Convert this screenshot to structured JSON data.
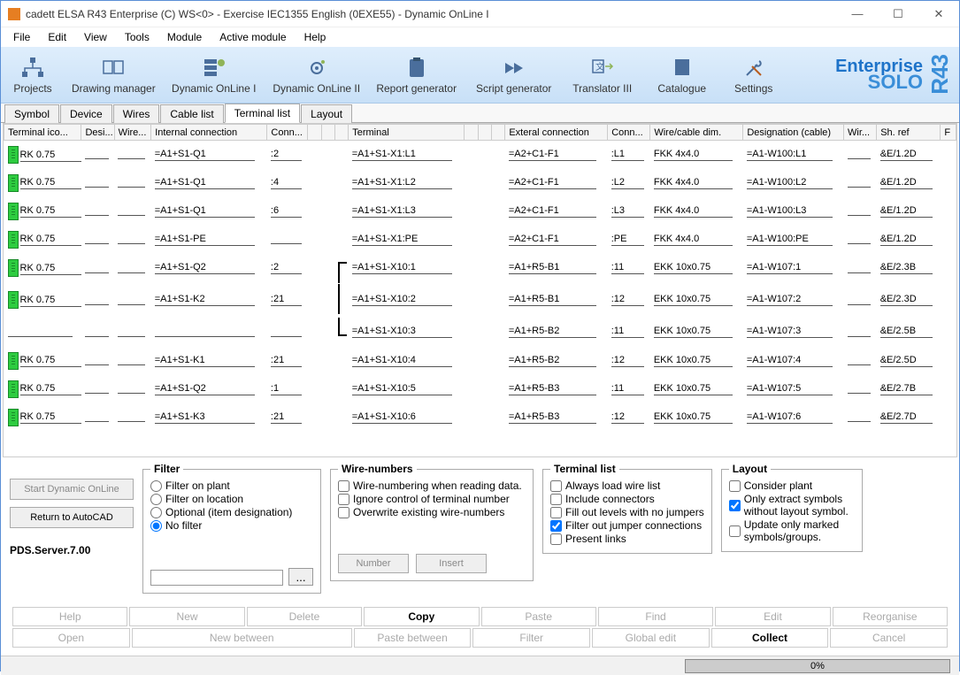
{
  "title": "cadett ELSA R43 Enterprise (C) WS<0> - Exercise IEC1355 English (0EXE55) - Dynamic OnLine I",
  "menu": [
    "File",
    "Edit",
    "View",
    "Tools",
    "Module",
    "Active module",
    "Help"
  ],
  "toolbar": [
    {
      "id": "projects",
      "label": "Projects"
    },
    {
      "id": "drawing-manager",
      "label": "Drawing manager"
    },
    {
      "id": "dynamic-online-1",
      "label": "Dynamic OnLine I"
    },
    {
      "id": "dynamic-online-2",
      "label": "Dynamic OnLine II"
    },
    {
      "id": "report-generator",
      "label": "Report generator"
    },
    {
      "id": "script-generator",
      "label": "Script generator"
    },
    {
      "id": "translator",
      "label": "Translator III"
    },
    {
      "id": "catalogue",
      "label": "Catalogue"
    },
    {
      "id": "settings",
      "label": "Settings"
    }
  ],
  "brand": {
    "line1": "Enterprise",
    "line2": "SOLO",
    "tag": "R43"
  },
  "tabs": [
    "Symbol",
    "Device",
    "Wires",
    "Cable list",
    "Terminal list",
    "Layout"
  ],
  "active_tab": "Terminal list",
  "columns": [
    "Terminal ico...",
    "Desi...",
    "Wire...",
    "Internal connection",
    "Conn...",
    "",
    "",
    "",
    "Terminal",
    "",
    "",
    "",
    "Exteral connection",
    "Conn...",
    "Wire/cable dim.",
    "Designation (cable)",
    "Wir...",
    "Sh. ref",
    "F"
  ],
  "rows": [
    {
      "tic": "RK 0.75",
      "int": "=A1+S1-Q1",
      "c1": ":2",
      "term": "=A1+S1-X1:L1",
      "ext": "=A2+C1-F1",
      "c2": ":L1",
      "dim": "FKK 4x4.0",
      "des": "=A1-W100:L1",
      "sh": "&E/1.2D"
    },
    {
      "tic": "RK 0.75",
      "int": "=A1+S1-Q1",
      "c1": ":4",
      "term": "=A1+S1-X1:L2",
      "ext": "=A2+C1-F1",
      "c2": ":L2",
      "dim": "FKK 4x4.0",
      "des": "=A1-W100:L2",
      "sh": "&E/1.2D"
    },
    {
      "tic": "RK 0.75",
      "int": "=A1+S1-Q1",
      "c1": ":6",
      "term": "=A1+S1-X1:L3",
      "ext": "=A2+C1-F1",
      "c2": ":L3",
      "dim": "FKK 4x4.0",
      "des": "=A1-W100:L3",
      "sh": "&E/1.2D"
    },
    {
      "tic": "RK 0.75",
      "int": "=A1+S1-PE",
      "c1": "",
      "term": "=A1+S1-X1:PE",
      "ext": "=A2+C1-F1",
      "c2": ":PE",
      "dim": "FKK 4x4.0",
      "des": "=A1-W100:PE",
      "sh": "&E/1.2D"
    },
    {
      "tic": "RK 0.75",
      "int": "=A1+S1-Q2",
      "c1": ":2",
      "term": "=A1+S1-X10:1",
      "ext": "=A1+R5-B1",
      "c2": ":11",
      "dim": "EKK 10x0.75",
      "des": "=A1-W107:1",
      "sh": "&E/2.3B",
      "br": "top"
    },
    {
      "tic": "RK 0.75",
      "int": "=A1+S1-K2",
      "c1": ":21",
      "term": "=A1+S1-X10:2",
      "ext": "=A1+R5-B1",
      "c2": ":12",
      "dim": "EKK 10x0.75",
      "des": "=A1-W107:2",
      "sh": "&E/2.3D",
      "br": "mid"
    },
    {
      "tic": "",
      "int": "",
      "c1": "",
      "term": "=A1+S1-X10:3",
      "ext": "=A1+R5-B2",
      "c2": ":11",
      "dim": "EKK 10x0.75",
      "des": "=A1-W107:3",
      "sh": "&E/2.5B",
      "br": "bot"
    },
    {
      "tic": "RK 0.75",
      "int": "=A1+S1-K1",
      "c1": ":21",
      "term": "=A1+S1-X10:4",
      "ext": "=A1+R5-B2",
      "c2": ":12",
      "dim": "EKK 10x0.75",
      "des": "=A1-W107:4",
      "sh": "&E/2.5D"
    },
    {
      "tic": "RK 0.75",
      "int": "=A1+S1-Q2",
      "c1": ":1",
      "term": "=A1+S1-X10:5",
      "ext": "=A1+R5-B3",
      "c2": ":11",
      "dim": "EKK 10x0.75",
      "des": "=A1-W107:5",
      "sh": "&E/2.7B"
    },
    {
      "tic": "RK 0.75",
      "int": "=A1+S1-K3",
      "c1": ":21",
      "term": "=A1+S1-X10:6",
      "ext": "=A1+R5-B3",
      "c2": ":12",
      "dim": "EKK 10x0.75",
      "des": "=A1-W107:6",
      "sh": "&E/2.7D"
    }
  ],
  "side": {
    "start": "Start Dynamic OnLine",
    "return": "Return to AutoCAD",
    "pds": "PDS.Server.7.00"
  },
  "filter": {
    "title": "Filter",
    "plant": "Filter on plant",
    "loc": "Filter on location",
    "opt": "Optional (item designation)",
    "none": "No filter",
    "browse": "..."
  },
  "wirenum": {
    "title": "Wire-numbers",
    "a": "Wire-numbering when reading data.",
    "b": "Ignore control of terminal number",
    "c": "Overwrite existing wire-numbers",
    "number": "Number",
    "insert": "Insert"
  },
  "termlist": {
    "title": "Terminal list",
    "a": "Always load wire list",
    "b": "Include connectors",
    "c": "Fill out levels with no jumpers",
    "d": "Filter out jumper connections",
    "e": "Present links"
  },
  "layout": {
    "title": "Layout",
    "a": "Consider plant",
    "b": "Only extract symbols without layout symbol.",
    "c": "Update only marked symbols/groups."
  },
  "actions": {
    "help": "Help",
    "new": "New",
    "delete": "Delete",
    "copy": "Copy",
    "paste": "Paste",
    "find": "Find",
    "edit": "Edit",
    "reorganise": "Reorganise",
    "open": "Open",
    "newbetween": "New between",
    "pastebetween": "Paste between",
    "filter": "Filter",
    "globaledit": "Global edit",
    "collect": "Collect",
    "cancel": "Cancel"
  },
  "progress": "0%"
}
